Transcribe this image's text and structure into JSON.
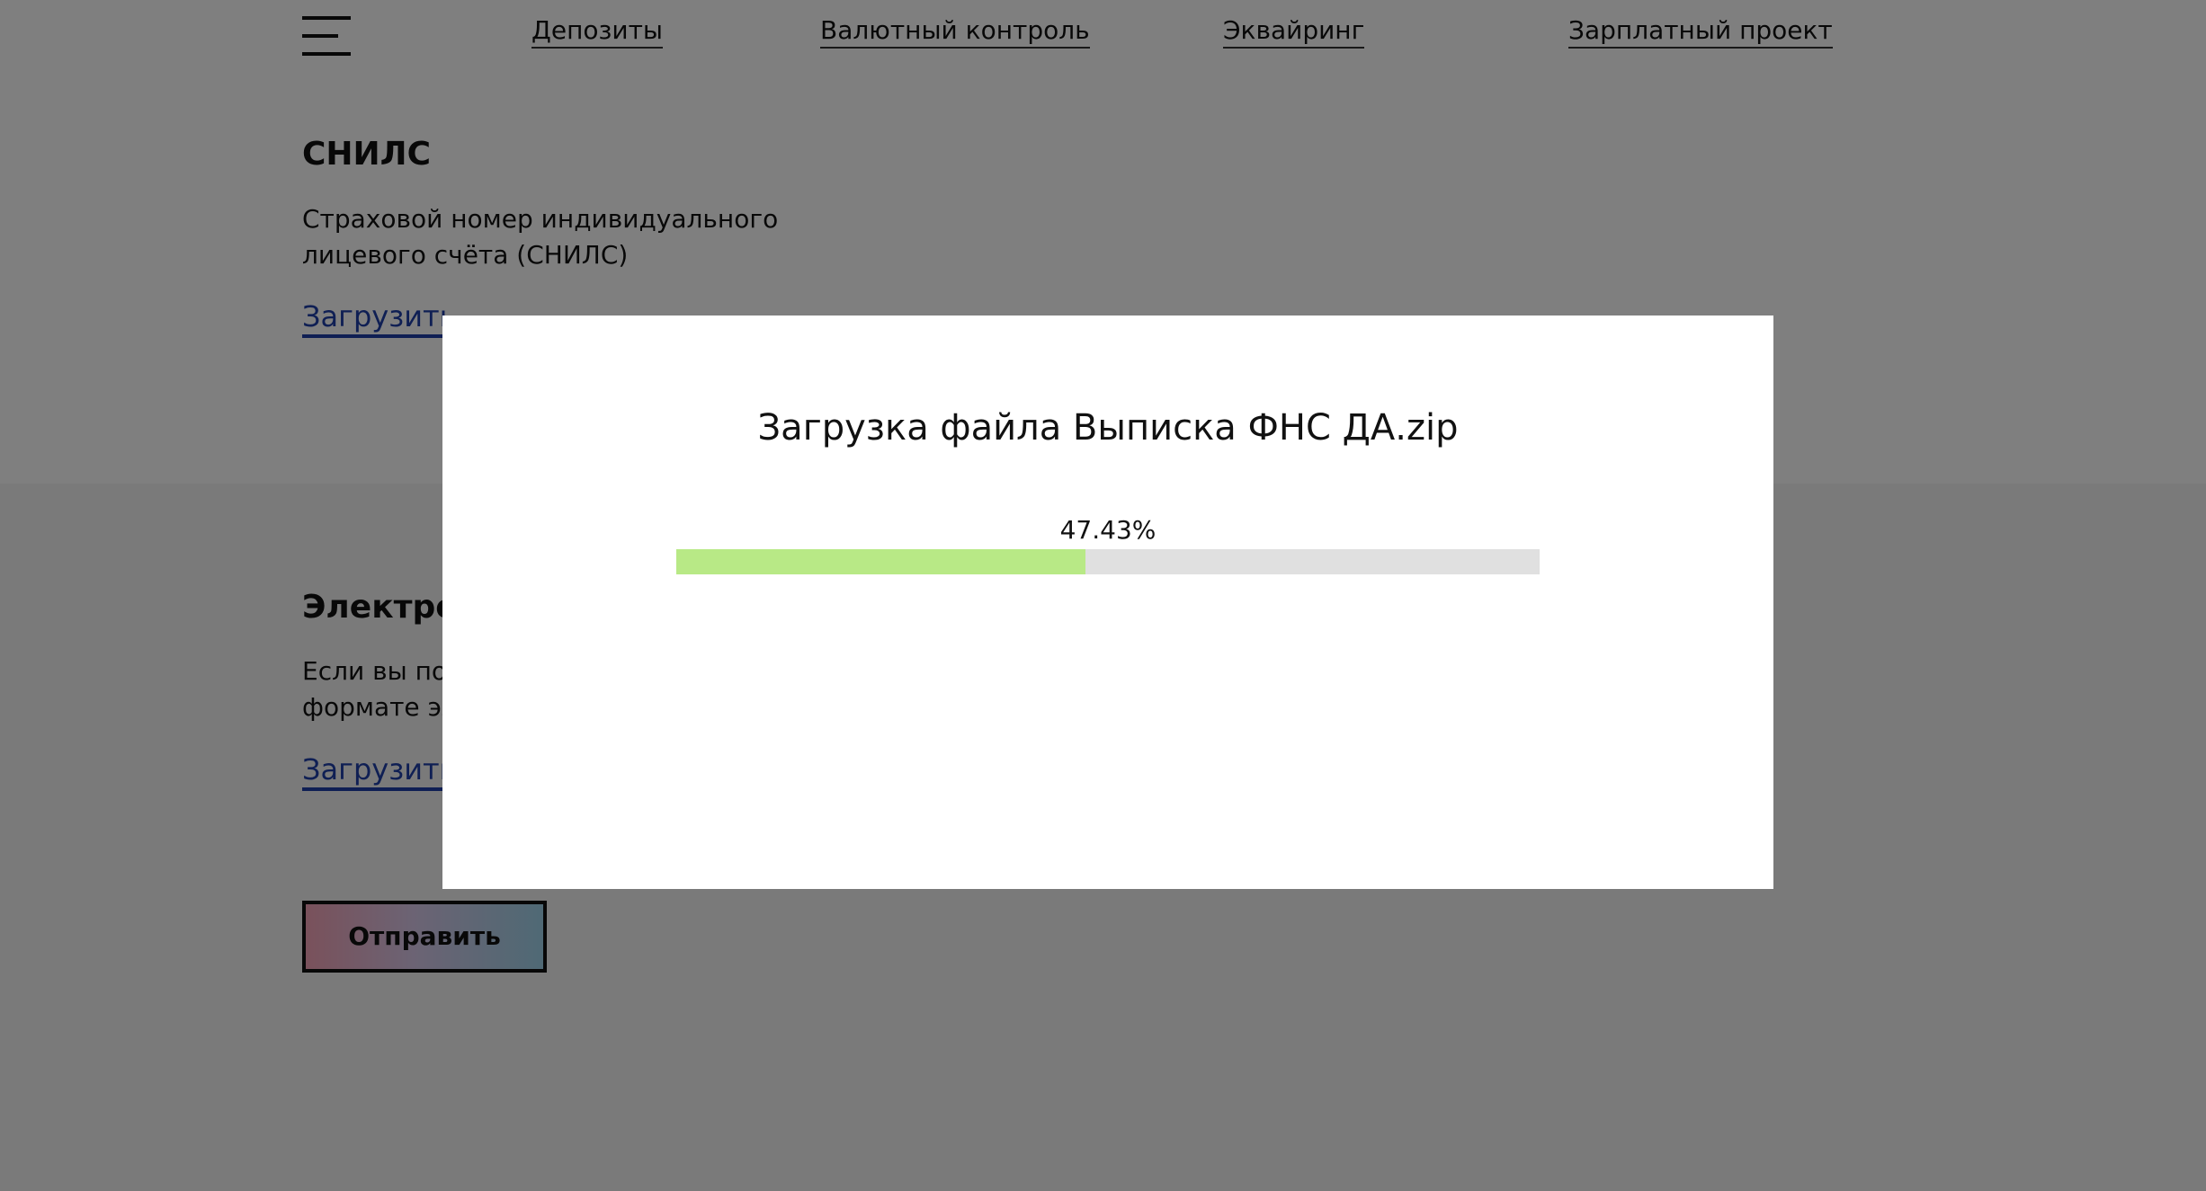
{
  "header": {
    "nav": [
      "Депозиты",
      "Валютный контроль",
      "Эквайринг",
      "Зарплатный проект"
    ]
  },
  "sections": {
    "snils": {
      "title": "СНИЛС",
      "description": "Страховой номер индивидуального лицевого счёта (СНИЛС)",
      "upload_label": "Загрузить"
    },
    "electronic": {
      "title": "Электро",
      "description_line1": "Если вы по",
      "description_line2": "формате эл",
      "upload_label": "Загрузить"
    }
  },
  "submit_label": "Отправить",
  "modal": {
    "title": "Загрузка файла Выписка ФНС ДА.zip",
    "progress_text": "47.43%",
    "progress_fraction": 0.4743
  },
  "colors": {
    "link": "#1f3fa8",
    "progress_fill": "#b8e986",
    "progress_track": "#e0e0e0"
  }
}
